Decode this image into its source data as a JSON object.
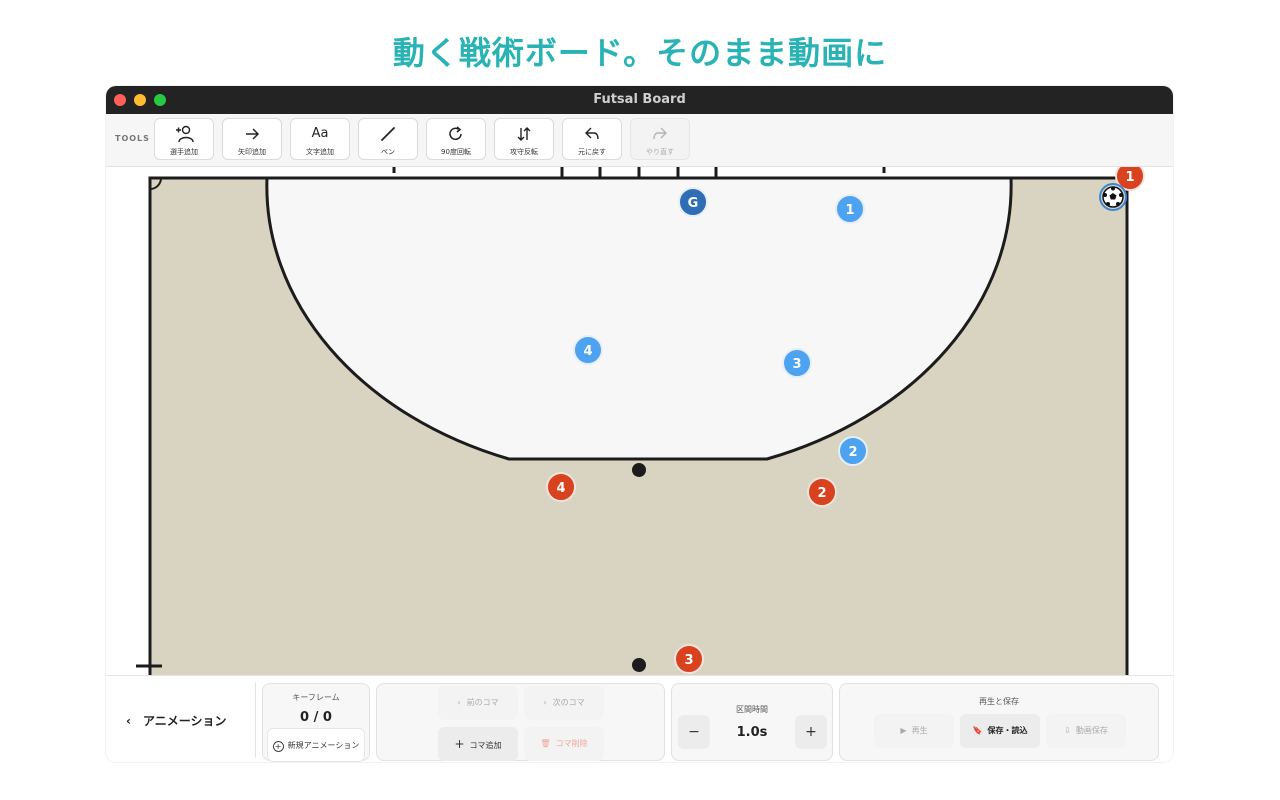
{
  "headline": "動く戦術ボード。そのまま動画に",
  "window": {
    "title": "Futsal Board"
  },
  "toolbar": {
    "label": "TOOLS",
    "items": [
      {
        "label": "選手追加",
        "icon": "add-player-icon"
      },
      {
        "label": "矢印追加",
        "icon": "arrow-right-icon"
      },
      {
        "label": "文字追加",
        "icon": "text-icon",
        "glyph": "Aa"
      },
      {
        "label": "ペン",
        "icon": "pen-icon"
      },
      {
        "label": "90度回転",
        "icon": "rotate-icon"
      },
      {
        "label": "攻守反転",
        "icon": "swap-icon"
      },
      {
        "label": "元に戻す",
        "icon": "undo-icon"
      },
      {
        "label": "やり直す",
        "icon": "redo-icon",
        "disabled": true
      }
    ]
  },
  "players": {
    "goalkeeper": "G",
    "blue": [
      "1",
      "4",
      "3",
      "2"
    ],
    "red": [
      "1",
      "4",
      "2",
      "3"
    ]
  },
  "colors": {
    "court": "#d9d4c2",
    "area": "#f7f7f7",
    "blue": "#4da3f0",
    "goalkeeper": "#2f6db5",
    "red": "#d9421e",
    "headline": "#29b3b4"
  },
  "bottom": {
    "animation_label": "アニメーション",
    "keyframe": {
      "title": "キーフレーム",
      "value": "0 / 0",
      "new_button": "新規アニメーション"
    },
    "frames": {
      "prev": "前のコマ",
      "next": "次のコマ",
      "add": "コマ追加",
      "delete": "コマ削除"
    },
    "interval": {
      "title": "区間時間",
      "value": "1.0s",
      "minus": "−",
      "plus": "+"
    },
    "playback": {
      "title": "再生と保存",
      "play": "再生",
      "save_load": "保存・読込",
      "video_save": "動画保存"
    }
  }
}
